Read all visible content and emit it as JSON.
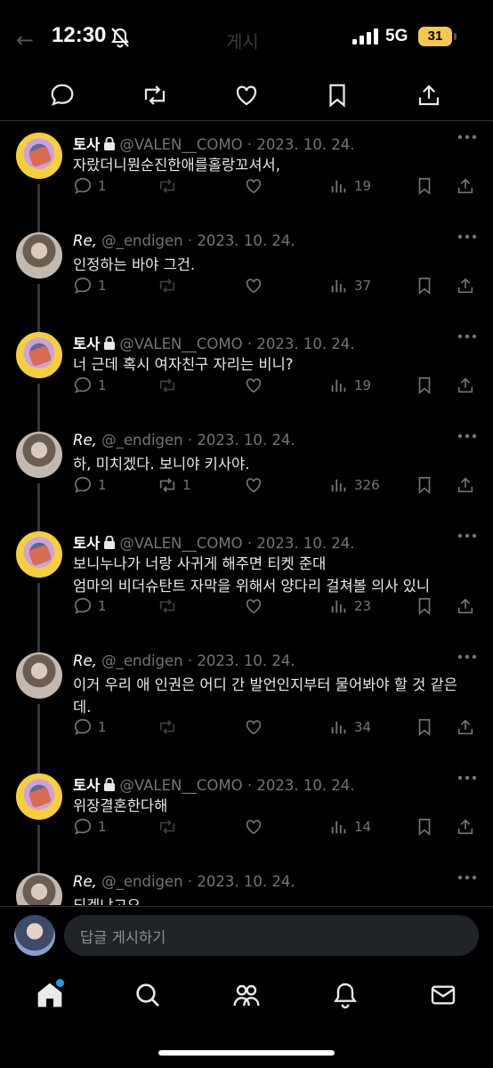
{
  "status_bar": {
    "time": "12:30",
    "back_glyph": "←",
    "ghost_title": "게시",
    "network": "5G",
    "battery": "31"
  },
  "top_actions": [
    "reply-icon",
    "repost-icon",
    "like-icon",
    "bookmark-icon",
    "share-icon"
  ],
  "posts": [
    {
      "author": "토사",
      "locked": true,
      "handle": "@VALEN__COMO",
      "date": "2023. 10. 24.",
      "text": "자랐더니뭔순진한애를홀랑꼬셔서,",
      "replies": "1",
      "reposts": "",
      "views": "19",
      "avatar": "toast"
    },
    {
      "author": "Re,",
      "locked": false,
      "handle": "@_endigen",
      "date": "2023. 10. 24.",
      "text": "인정하는 바야 그건.",
      "replies": "1",
      "reposts": "",
      "views": "37",
      "avatar": "re"
    },
    {
      "author": "토사",
      "locked": true,
      "handle": "@VALEN__COMO",
      "date": "2023. 10. 24.",
      "text": "너 근데 혹시 여자친구 자리는 비니?",
      "replies": "1",
      "reposts": "",
      "views": "19",
      "avatar": "toast"
    },
    {
      "author": "Re,",
      "locked": false,
      "handle": "@_endigen",
      "date": "2023. 10. 24.",
      "text": "하, 미치겠다. 보니야 키사야.",
      "replies": "1",
      "reposts": "1",
      "views": "326",
      "avatar": "re"
    },
    {
      "author": "토사",
      "locked": true,
      "handle": "@VALEN__COMO",
      "date": "2023. 10. 24.",
      "text": "보니누나가 너랑 사귀게 해주면 티켓 준대\n엄마의 비더슈탄트 자막을 위해서 양다리 걸쳐볼 의사 있니",
      "replies": "1",
      "reposts": "",
      "views": "23",
      "avatar": "toast"
    },
    {
      "author": "Re,",
      "locked": false,
      "handle": "@_endigen",
      "date": "2023. 10. 24.",
      "text": "이거 우리 애 인권은 어디 간 발언인지부터 물어봐야 할 것 같은데.",
      "replies": "1",
      "reposts": "",
      "views": "34",
      "avatar": "re"
    },
    {
      "author": "토사",
      "locked": true,
      "handle": "@VALEN__COMO",
      "date": "2023. 10. 24.",
      "text": "위장결혼한다해",
      "replies": "1",
      "reposts": "",
      "views": "14",
      "avatar": "toast"
    },
    {
      "author": "Re,",
      "locked": false,
      "handle": "@_endigen",
      "date": "2023. 10. 24.",
      "text": "되겠냐고요",
      "replies": "",
      "reposts": "",
      "views": "",
      "avatar": "re"
    }
  ],
  "reply_box": {
    "placeholder": "답글 게시하기"
  },
  "bottom_nav": [
    "home-icon",
    "search-icon",
    "communities-icon",
    "notifications-icon",
    "messages-icon"
  ],
  "colors": {
    "background": "#000000",
    "muted": "#71767b",
    "accent": "#1d9bf0",
    "divider": "#2f3336"
  }
}
